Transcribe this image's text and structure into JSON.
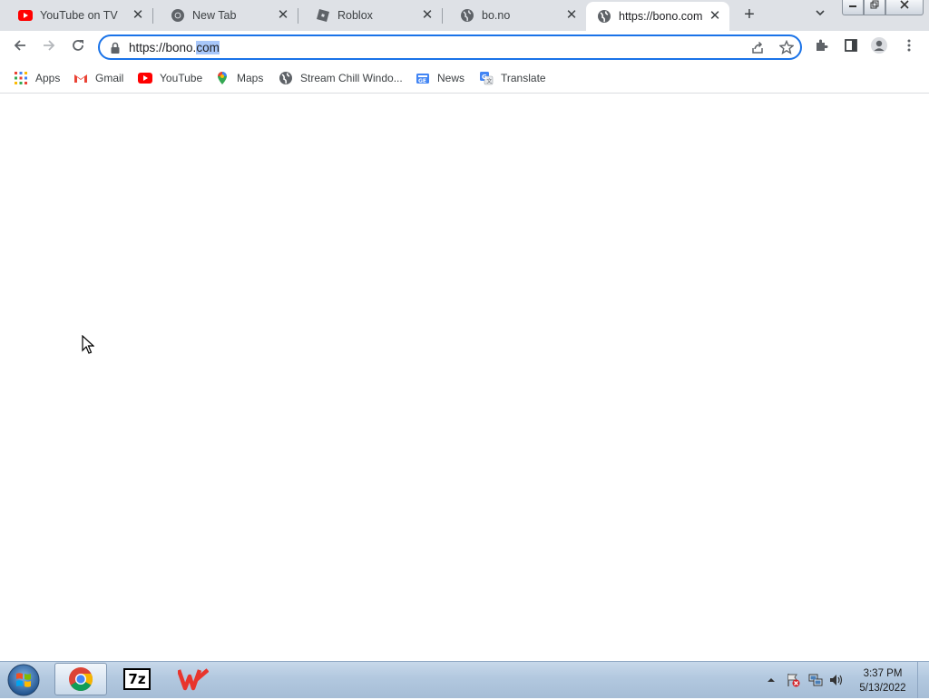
{
  "browser": {
    "tabs": [
      {
        "title": "YouTube on TV",
        "favicon": "youtube-icon"
      },
      {
        "title": "New Tab",
        "favicon": "chrome-icon"
      },
      {
        "title": "Roblox",
        "favicon": "roblox-icon"
      },
      {
        "title": "bo.no",
        "favicon": "globe-icon"
      },
      {
        "title": "https://bono.com",
        "favicon": "globe-icon",
        "active": true
      }
    ],
    "address_bar": {
      "url_prefix": "https://bono.",
      "url_selected": "com",
      "secure_icon": "lock-icon"
    },
    "bookmarks": [
      {
        "label": "Apps",
        "icon": "apps-grid-icon"
      },
      {
        "label": "Gmail",
        "icon": "gmail-icon"
      },
      {
        "label": "YouTube",
        "icon": "youtube-icon"
      },
      {
        "label": "Maps",
        "icon": "maps-icon"
      },
      {
        "label": "Stream Chill Windo...",
        "icon": "globe-icon"
      },
      {
        "label": "News",
        "icon": "news-icon"
      },
      {
        "label": "Translate",
        "icon": "translate-icon"
      }
    ]
  },
  "taskbar": {
    "pinned": [
      "chrome-icon",
      "7zip-icon",
      "wps-office-icon"
    ],
    "seven_zip_label": "7z",
    "clock_time": "3:37 PM",
    "clock_date": "5/13/2022"
  },
  "colors": {
    "tabstrip_bg": "#dee1e6",
    "accent": "#1a73e8",
    "selection": "#a8c7fa",
    "taskbar_bg": "#b2c8df"
  }
}
